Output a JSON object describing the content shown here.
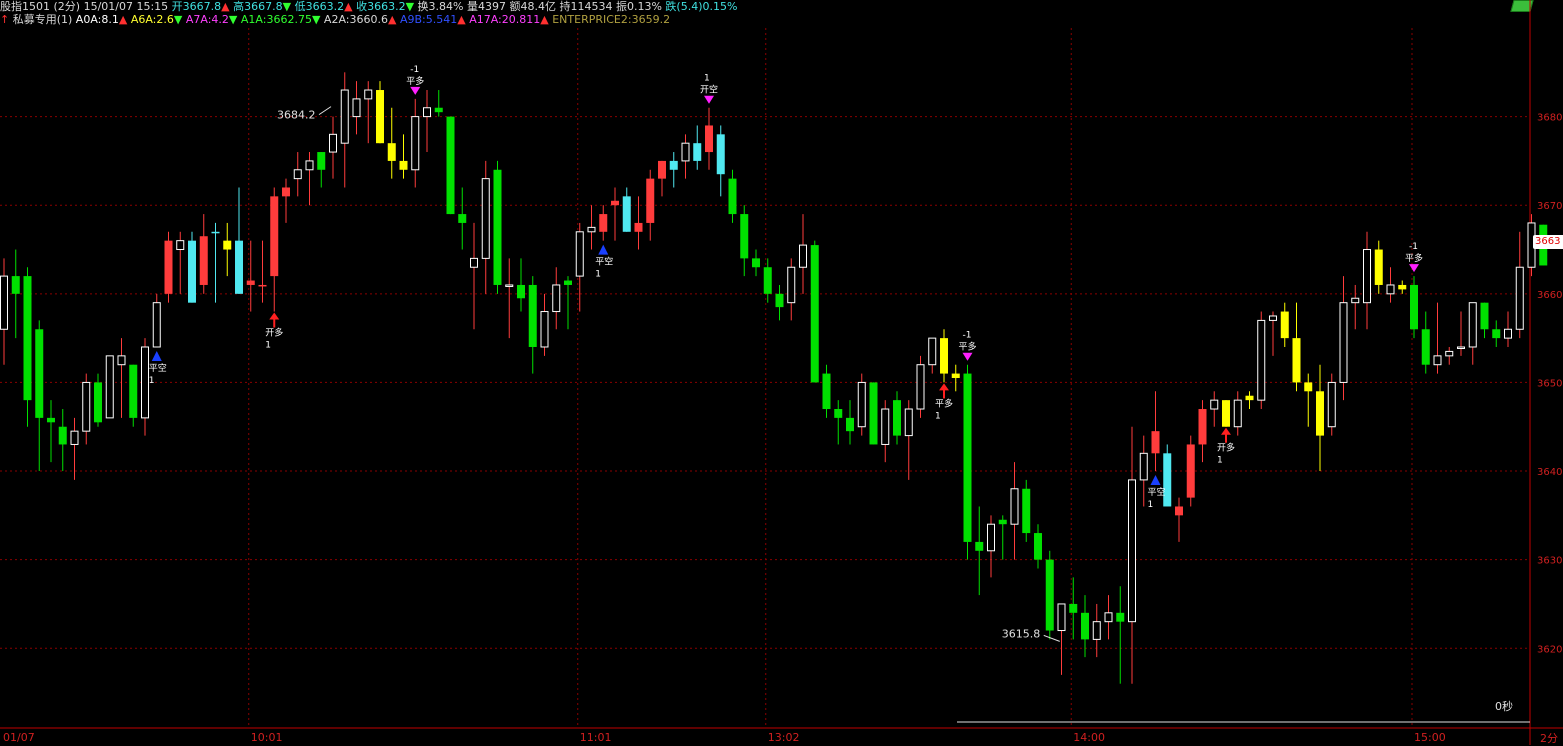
{
  "header": {
    "line1": [
      {
        "text": "股指1501 (2分) 15/01/07 15:15 ",
        "color": "#d8d8d8"
      },
      {
        "text": "开3667.8",
        "color": "#40e0e0"
      },
      {
        "text": "▲",
        "color": "#ff3030"
      },
      {
        "text": " 高3667.8",
        "color": "#40e0e0"
      },
      {
        "text": "▼",
        "color": "#30ff30"
      },
      {
        "text": " 低3663.2",
        "color": "#40e0e0"
      },
      {
        "text": "▲",
        "color": "#ff3030"
      },
      {
        "text": " 收3663.2",
        "color": "#40e0e0"
      },
      {
        "text": "▼",
        "color": "#30ff30"
      },
      {
        "text": " 换3.84% 量4397 额48.4亿 持114534 振0.13% ",
        "color": "#d8d8d8"
      },
      {
        "text": "跌(5.4)0.15%",
        "color": "#40e0e0"
      }
    ],
    "line2": [
      {
        "text": "↑ ",
        "color": "#ff3030"
      },
      {
        "text": "私募专用(1) ",
        "color": "#d8d8d8"
      },
      {
        "text": "A0A:8.1",
        "color": "#ffffff"
      },
      {
        "text": "▲ ",
        "color": "#ff3030"
      },
      {
        "text": "A6A:2.6",
        "color": "#ffff30"
      },
      {
        "text": "▼ ",
        "color": "#30ff30"
      },
      {
        "text": "A7A:4.2",
        "color": "#ff40ff"
      },
      {
        "text": "▼ ",
        "color": "#30ff30"
      },
      {
        "text": "A1A:3662.75",
        "color": "#30ff30"
      },
      {
        "text": "▼ ",
        "color": "#30ff30"
      },
      {
        "text": "A2A:3660.6",
        "color": "#d8d8d8"
      },
      {
        "text": "▲ ",
        "color": "#ff3030"
      },
      {
        "text": "A9B:5.541",
        "color": "#3050ff"
      },
      {
        "text": "▲ ",
        "color": "#ff3030"
      },
      {
        "text": "A17A:20.811",
        "color": "#ff40ff"
      },
      {
        "text": "▲ ",
        "color": "#ff3030"
      },
      {
        "text": "ENTERPRICE2:3659.2",
        "color": "#b0a040"
      }
    ]
  },
  "right_panel": {
    "current_price": "3663",
    "countdown": "0秒",
    "period": "2分"
  },
  "icons": {
    "money": "money-stack-icon"
  },
  "chart_data": {
    "type": "candlestick",
    "y_axis": {
      "ylim": [
        3611,
        3690
      ],
      "ticks": [
        3620,
        3630,
        3640,
        3650,
        3660,
        3670,
        3680
      ],
      "tick_labels": [
        "3620",
        "3630",
        "3640",
        "3650",
        "3660",
        "3670",
        "3680"
      ],
      "position": "right"
    },
    "x_axis": {
      "labels": [
        "01/07",
        "10:01",
        "11:01",
        "13:02",
        "14:00",
        "15:00"
      ],
      "label_index": [
        0,
        21,
        49,
        65,
        91,
        120
      ]
    },
    "grid": true,
    "high_annotation": {
      "text": "3684.2",
      "index": 28
    },
    "low_annotation": {
      "text": "3615.8",
      "index": 89
    },
    "candles": [
      {
        "o": 3656,
        "h": 3664,
        "l": 3652,
        "c": 3662,
        "col": "up"
      },
      {
        "o": 3660,
        "h": 3665,
        "l": 3655,
        "c": 3662,
        "col": "g"
      },
      {
        "o": 3662,
        "h": 3663,
        "l": 3645,
        "c": 3648,
        "col": "g"
      },
      {
        "o": 3656,
        "h": 3657,
        "l": 3640,
        "c": 3646,
        "col": "g"
      },
      {
        "o": 3646,
        "h": 3648,
        "l": 3641,
        "c": 3645.5,
        "col": "g"
      },
      {
        "o": 3645,
        "h": 3647,
        "l": 3640,
        "c": 3643,
        "col": "g"
      },
      {
        "o": 3643,
        "h": 3646,
        "l": 3639,
        "c": 3644.5,
        "col": "up"
      },
      {
        "o": 3644.5,
        "h": 3651,
        "l": 3643,
        "c": 3650,
        "col": "up"
      },
      {
        "o": 3650,
        "h": 3651,
        "l": 3645,
        "c": 3645.5,
        "col": "g"
      },
      {
        "o": 3646,
        "h": 3652,
        "l": 3646,
        "c": 3653,
        "col": "up"
      },
      {
        "o": 3652,
        "h": 3655,
        "l": 3646,
        "c": 3653,
        "col": "up"
      },
      {
        "o": 3652,
        "h": 3652,
        "l": 3645,
        "c": 3646,
        "col": "g"
      },
      {
        "o": 3646,
        "h": 3655,
        "l": 3644,
        "c": 3654,
        "col": "up"
      },
      {
        "o": 3654,
        "h": 3660,
        "l": 3654,
        "c": 3659,
        "col": "up"
      },
      {
        "o": 3660,
        "h": 3667,
        "l": 3659,
        "c": 3666,
        "col": "r"
      },
      {
        "o": 3665,
        "h": 3667,
        "l": 3660,
        "c": 3666,
        "col": "up"
      },
      {
        "o": 3666,
        "h": 3667,
        "l": 3659,
        "c": 3659,
        "col": "cy"
      },
      {
        "o": 3661,
        "h": 3669,
        "l": 3660,
        "c": 3666.5,
        "col": "r"
      },
      {
        "o": 3667,
        "h": 3668,
        "l": 3659,
        "c": 3667,
        "col": "cy"
      },
      {
        "o": 3665,
        "h": 3668,
        "l": 3662,
        "c": 3666,
        "col": "y"
      },
      {
        "o": 3666,
        "h": 3672,
        "l": 3660,
        "c": 3660,
        "col": "cy"
      },
      {
        "o": 3661,
        "h": 3666,
        "l": 3658,
        "c": 3661.5,
        "col": "r"
      },
      {
        "o": 3661,
        "h": 3666,
        "l": 3659,
        "c": 3661,
        "col": "r"
      },
      {
        "o": 3662,
        "h": 3672,
        "l": 3658,
        "c": 3671,
        "col": "r"
      },
      {
        "o": 3671,
        "h": 3673,
        "l": 3668,
        "c": 3672,
        "col": "r"
      },
      {
        "o": 3673,
        "h": 3676,
        "l": 3671,
        "c": 3674,
        "col": "up"
      },
      {
        "o": 3674,
        "h": 3676,
        "l": 3670,
        "c": 3675,
        "col": "up"
      },
      {
        "o": 3674,
        "h": 3676,
        "l": 3672,
        "c": 3676,
        "col": "g"
      },
      {
        "o": 3676,
        "h": 3680,
        "l": 3673,
        "c": 3678,
        "col": "up"
      },
      {
        "o": 3677,
        "h": 3685,
        "l": 3672,
        "c": 3683,
        "col": "up"
      },
      {
        "o": 3682,
        "h": 3684,
        "l": 3678,
        "c": 3680,
        "col": "up"
      },
      {
        "o": 3682,
        "h": 3684,
        "l": 3677,
        "c": 3683,
        "col": "up"
      },
      {
        "o": 3683,
        "h": 3684,
        "l": 3677,
        "c": 3677,
        "col": "y"
      },
      {
        "o": 3677,
        "h": 3681,
        "l": 3673,
        "c": 3675,
        "col": "y"
      },
      {
        "o": 3675,
        "h": 3678,
        "l": 3673,
        "c": 3674,
        "col": "y"
      },
      {
        "o": 3674,
        "h": 3682,
        "l": 3672,
        "c": 3680,
        "col": "up"
      },
      {
        "o": 3680,
        "h": 3683,
        "l": 3676,
        "c": 3681,
        "col": "up"
      },
      {
        "o": 3681,
        "h": 3683,
        "l": 3680,
        "c": 3680.5,
        "col": "g"
      },
      {
        "o": 3680,
        "h": 3680,
        "l": 3669,
        "c": 3669,
        "col": "g"
      },
      {
        "o": 3669,
        "h": 3672,
        "l": 3665,
        "c": 3668,
        "col": "g"
      },
      {
        "o": 3664,
        "h": 3668,
        "l": 3656,
        "c": 3663,
        "col": "up"
      },
      {
        "o": 3664,
        "h": 3675,
        "l": 3660,
        "c": 3673,
        "col": "up"
      },
      {
        "o": 3674,
        "h": 3675,
        "l": 3660,
        "c": 3661,
        "col": "g"
      },
      {
        "o": 3661,
        "h": 3664,
        "l": 3655,
        "c": 3661,
        "col": "up"
      },
      {
        "o": 3661,
        "h": 3664,
        "l": 3658,
        "c": 3659.5,
        "col": "g"
      },
      {
        "o": 3661,
        "h": 3662,
        "l": 3651,
        "c": 3654,
        "col": "g"
      },
      {
        "o": 3654,
        "h": 3660,
        "l": 3653,
        "c": 3658,
        "col": "up"
      },
      {
        "o": 3658,
        "h": 3663,
        "l": 3656,
        "c": 3661,
        "col": "up"
      },
      {
        "o": 3661,
        "h": 3662,
        "l": 3656,
        "c": 3661.5,
        "col": "g"
      },
      {
        "o": 3662,
        "h": 3668,
        "l": 3658,
        "c": 3667,
        "col": "up"
      },
      {
        "o": 3667,
        "h": 3670,
        "l": 3665,
        "c": 3667.5,
        "col": "up"
      },
      {
        "o": 3667,
        "h": 3670,
        "l": 3666,
        "c": 3669,
        "col": "r"
      },
      {
        "o": 3670,
        "h": 3672,
        "l": 3666,
        "c": 3670.5,
        "col": "r"
      },
      {
        "o": 3671,
        "h": 3672,
        "l": 3667,
        "c": 3667,
        "col": "cy"
      },
      {
        "o": 3667,
        "h": 3671,
        "l": 3665,
        "c": 3668,
        "col": "r"
      },
      {
        "o": 3668,
        "h": 3674,
        "l": 3666,
        "c": 3673,
        "col": "r"
      },
      {
        "o": 3673,
        "h": 3675,
        "l": 3671,
        "c": 3675,
        "col": "r"
      },
      {
        "o": 3674,
        "h": 3676,
        "l": 3672,
        "c": 3675,
        "col": "cy"
      },
      {
        "o": 3675,
        "h": 3678,
        "l": 3673,
        "c": 3677,
        "col": "up"
      },
      {
        "o": 3677,
        "h": 3679,
        "l": 3674,
        "c": 3675,
        "col": "cy"
      },
      {
        "o": 3676,
        "h": 3681,
        "l": 3674,
        "c": 3679,
        "col": "r"
      },
      {
        "o": 3678,
        "h": 3679,
        "l": 3671,
        "c": 3673.5,
        "col": "cy"
      },
      {
        "o": 3673,
        "h": 3674,
        "l": 3668,
        "c": 3669,
        "col": "g"
      },
      {
        "o": 3669,
        "h": 3670,
        "l": 3662,
        "c": 3664,
        "col": "g"
      },
      {
        "o": 3664,
        "h": 3665,
        "l": 3662,
        "c": 3663,
        "col": "g"
      },
      {
        "o": 3663,
        "h": 3664,
        "l": 3659,
        "c": 3660,
        "col": "g"
      },
      {
        "o": 3660,
        "h": 3661,
        "l": 3657,
        "c": 3658.5,
        "col": "g"
      },
      {
        "o": 3659,
        "h": 3664,
        "l": 3657,
        "c": 3663,
        "col": "up"
      },
      {
        "o": 3663,
        "h": 3669,
        "l": 3660,
        "c": 3665.5,
        "col": "up"
      },
      {
        "o": 3665.5,
        "h": 3666,
        "l": 3650,
        "c": 3650,
        "col": "g"
      },
      {
        "o": 3651,
        "h": 3652,
        "l": 3646,
        "c": 3647,
        "col": "g"
      },
      {
        "o": 3647,
        "h": 3648,
        "l": 3643,
        "c": 3646,
        "col": "g"
      },
      {
        "o": 3646,
        "h": 3648,
        "l": 3643,
        "c": 3644.5,
        "col": "g"
      },
      {
        "o": 3645,
        "h": 3651,
        "l": 3644,
        "c": 3650,
        "col": "up"
      },
      {
        "o": 3650,
        "h": 3650,
        "l": 3643,
        "c": 3643,
        "col": "g"
      },
      {
        "o": 3643,
        "h": 3648,
        "l": 3641,
        "c": 3647,
        "col": "up"
      },
      {
        "o": 3648,
        "h": 3649,
        "l": 3643,
        "c": 3644,
        "col": "g"
      },
      {
        "o": 3644,
        "h": 3648,
        "l": 3639,
        "c": 3647,
        "col": "up"
      },
      {
        "o": 3647,
        "h": 3653,
        "l": 3646,
        "c": 3652,
        "col": "up"
      },
      {
        "o": 3652,
        "h": 3655,
        "l": 3651,
        "c": 3655,
        "col": "up"
      },
      {
        "o": 3655,
        "h": 3656,
        "l": 3650,
        "c": 3651,
        "col": "y"
      },
      {
        "o": 3651,
        "h": 3652,
        "l": 3649,
        "c": 3650.5,
        "col": "y"
      },
      {
        "o": 3651,
        "h": 3652,
        "l": 3630,
        "c": 3632,
        "col": "g"
      },
      {
        "o": 3632,
        "h": 3636,
        "l": 3626,
        "c": 3631,
        "col": "g"
      },
      {
        "o": 3631,
        "h": 3635,
        "l": 3628,
        "c": 3634,
        "col": "up"
      },
      {
        "o": 3634,
        "h": 3635,
        "l": 3630,
        "c": 3634.5,
        "col": "g"
      },
      {
        "o": 3634,
        "h": 3641,
        "l": 3630,
        "c": 3638,
        "col": "up"
      },
      {
        "o": 3638,
        "h": 3639,
        "l": 3632,
        "c": 3633,
        "col": "g"
      },
      {
        "o": 3633,
        "h": 3634,
        "l": 3629,
        "c": 3630,
        "col": "g"
      },
      {
        "o": 3630,
        "h": 3631,
        "l": 3621,
        "c": 3622,
        "col": "g"
      },
      {
        "o": 3622,
        "h": 3625,
        "l": 3617,
        "c": 3625,
        "col": "up"
      },
      {
        "o": 3625,
        "h": 3628,
        "l": 3621,
        "c": 3624,
        "col": "g"
      },
      {
        "o": 3624,
        "h": 3626,
        "l": 3619,
        "c": 3621,
        "col": "g"
      },
      {
        "o": 3621,
        "h": 3625,
        "l": 3619,
        "c": 3623,
        "col": "up"
      },
      {
        "o": 3623,
        "h": 3626,
        "l": 3621,
        "c": 3624,
        "col": "up"
      },
      {
        "o": 3624,
        "h": 3627,
        "l": 3616,
        "c": 3623,
        "col": "g"
      },
      {
        "o": 3623,
        "h": 3645,
        "l": 3616,
        "c": 3639,
        "col": "up"
      },
      {
        "o": 3639,
        "h": 3644,
        "l": 3636,
        "c": 3642,
        "col": "up"
      },
      {
        "o": 3642,
        "h": 3649,
        "l": 3640,
        "c": 3644.5,
        "col": "r"
      },
      {
        "o": 3642,
        "h": 3643,
        "l": 3636,
        "c": 3636,
        "col": "cy"
      },
      {
        "o": 3635,
        "h": 3637,
        "l": 3632,
        "c": 3636,
        "col": "r"
      },
      {
        "o": 3637,
        "h": 3644,
        "l": 3636,
        "c": 3643,
        "col": "r"
      },
      {
        "o": 3643,
        "h": 3648,
        "l": 3641,
        "c": 3647,
        "col": "r"
      },
      {
        "o": 3647,
        "h": 3649,
        "l": 3645,
        "c": 3648,
        "col": "up"
      },
      {
        "o": 3648,
        "h": 3648,
        "l": 3645,
        "c": 3645,
        "col": "y"
      },
      {
        "o": 3645,
        "h": 3649,
        "l": 3644,
        "c": 3648,
        "col": "up"
      },
      {
        "o": 3648,
        "h": 3649,
        "l": 3647,
        "c": 3648.5,
        "col": "y"
      },
      {
        "o": 3648,
        "h": 3658,
        "l": 3647,
        "c": 3657,
        "col": "up"
      },
      {
        "o": 3657,
        "h": 3658,
        "l": 3653,
        "c": 3657.5,
        "col": "up"
      },
      {
        "o": 3658,
        "h": 3659,
        "l": 3654,
        "c": 3655,
        "col": "y"
      },
      {
        "o": 3655,
        "h": 3659,
        "l": 3649,
        "c": 3650,
        "col": "y"
      },
      {
        "o": 3650,
        "h": 3651,
        "l": 3645,
        "c": 3649,
        "col": "y"
      },
      {
        "o": 3649,
        "h": 3652,
        "l": 3640,
        "c": 3644,
        "col": "y"
      },
      {
        "o": 3645,
        "h": 3651,
        "l": 3644,
        "c": 3650,
        "col": "up"
      },
      {
        "o": 3650,
        "h": 3662,
        "l": 3648,
        "c": 3659,
        "col": "up"
      },
      {
        "o": 3659,
        "h": 3661,
        "l": 3656,
        "c": 3659.5,
        "col": "up"
      },
      {
        "o": 3659,
        "h": 3667,
        "l": 3656,
        "c": 3665,
        "col": "up"
      },
      {
        "o": 3665,
        "h": 3666,
        "l": 3660,
        "c": 3661,
        "col": "y"
      },
      {
        "o": 3660,
        "h": 3663,
        "l": 3659,
        "c": 3661,
        "col": "up"
      },
      {
        "o": 3661,
        "h": 3661.5,
        "l": 3660,
        "c": 3660.5,
        "col": "y"
      },
      {
        "o": 3661,
        "h": 3662,
        "l": 3655,
        "c": 3656,
        "col": "g"
      },
      {
        "o": 3656,
        "h": 3658,
        "l": 3651,
        "c": 3652,
        "col": "g"
      },
      {
        "o": 3652,
        "h": 3659,
        "l": 3651,
        "c": 3653,
        "col": "up"
      },
      {
        "o": 3653,
        "h": 3654,
        "l": 3652,
        "c": 3653.5,
        "col": "up"
      },
      {
        "o": 3654,
        "h": 3658,
        "l": 3653,
        "c": 3654,
        "col": "up"
      },
      {
        "o": 3654,
        "h": 3659,
        "l": 3652,
        "c": 3659,
        "col": "up"
      },
      {
        "o": 3659,
        "h": 3659,
        "l": 3655,
        "c": 3656,
        "col": "g"
      },
      {
        "o": 3656,
        "h": 3657,
        "l": 3654,
        "c": 3655,
        "col": "g"
      },
      {
        "o": 3655,
        "h": 3658,
        "l": 3654,
        "c": 3656,
        "col": "up"
      },
      {
        "o": 3656,
        "h": 3667,
        "l": 3655,
        "c": 3663,
        "col": "up"
      },
      {
        "o": 3663,
        "h": 3669,
        "l": 3662,
        "c": 3668,
        "col": "up"
      },
      {
        "o": 3667.8,
        "h": 3667.8,
        "l": 3663.2,
        "c": 3663.2,
        "col": "g"
      }
    ],
    "signals": [
      {
        "i": 13,
        "type": "buy_close",
        "label": "平空",
        "qty": "1"
      },
      {
        "i": 23,
        "type": "buy_open",
        "label": "开多",
        "qty": "1"
      },
      {
        "i": 35,
        "type": "sell_close",
        "label": "平多",
        "qty": "-1"
      },
      {
        "i": 51,
        "type": "buy_close",
        "label": "平空",
        "qty": "1"
      },
      {
        "i": 60,
        "type": "sell_close",
        "label": "开空",
        "qty": "1"
      },
      {
        "i": 80,
        "type": "buy_open",
        "label": "平多",
        "qty": "1"
      },
      {
        "i": 82,
        "type": "sell_close",
        "label": "平多",
        "qty": "-1"
      },
      {
        "i": 98,
        "type": "buy_close",
        "label": "平空",
        "qty": "1"
      },
      {
        "i": 104,
        "type": "buy_open",
        "label": "开多",
        "qty": "1"
      },
      {
        "i": 120,
        "type": "sell_close",
        "label": "平多",
        "qty": "-1"
      }
    ],
    "colors": {
      "up": "#ff3c3c",
      "r": "#ff3c3c",
      "g": "#00e000",
      "y": "#ffff00",
      "cy": "#50e8f0",
      "grid": "#8a0000"
    }
  }
}
